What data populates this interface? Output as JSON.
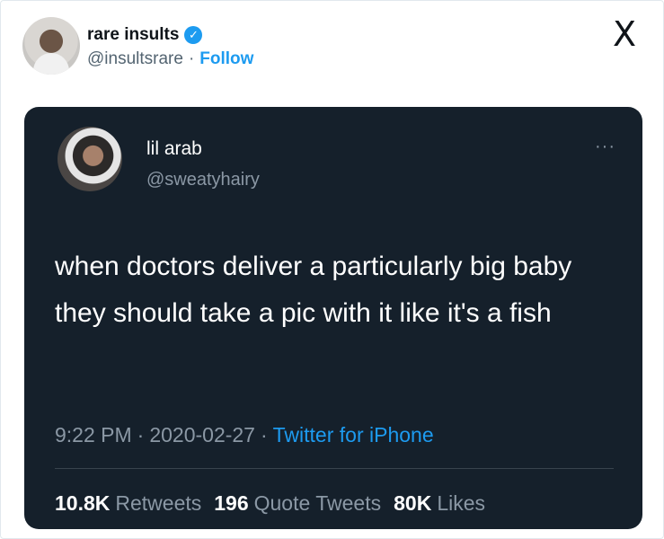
{
  "embed": {
    "author_name": "rare insults",
    "verified_icon": "verified-badge-icon",
    "author_handle": "@insultsrare",
    "separator": "·",
    "follow_label": "Follow",
    "platform_logo": "X"
  },
  "tweet": {
    "author_name": "lil arab",
    "author_handle": "@sweatyhairy",
    "more": "···",
    "text": "when doctors deliver a particularly big baby they should take a pic with it like it's a fish",
    "time": "9:22 PM",
    "date": "2020-02-27",
    "source": "Twitter for iPhone",
    "separator": "·",
    "stats": {
      "retweets_count": "10.8K",
      "retweets_label": "Retweets",
      "quotes_count": "196",
      "quotes_label": "Quote Tweets",
      "likes_count": "80K",
      "likes_label": "Likes"
    }
  },
  "colors": {
    "card_background": "#15202b",
    "accent": "#1d9bf0",
    "secondary_text": "#8b98a5"
  }
}
